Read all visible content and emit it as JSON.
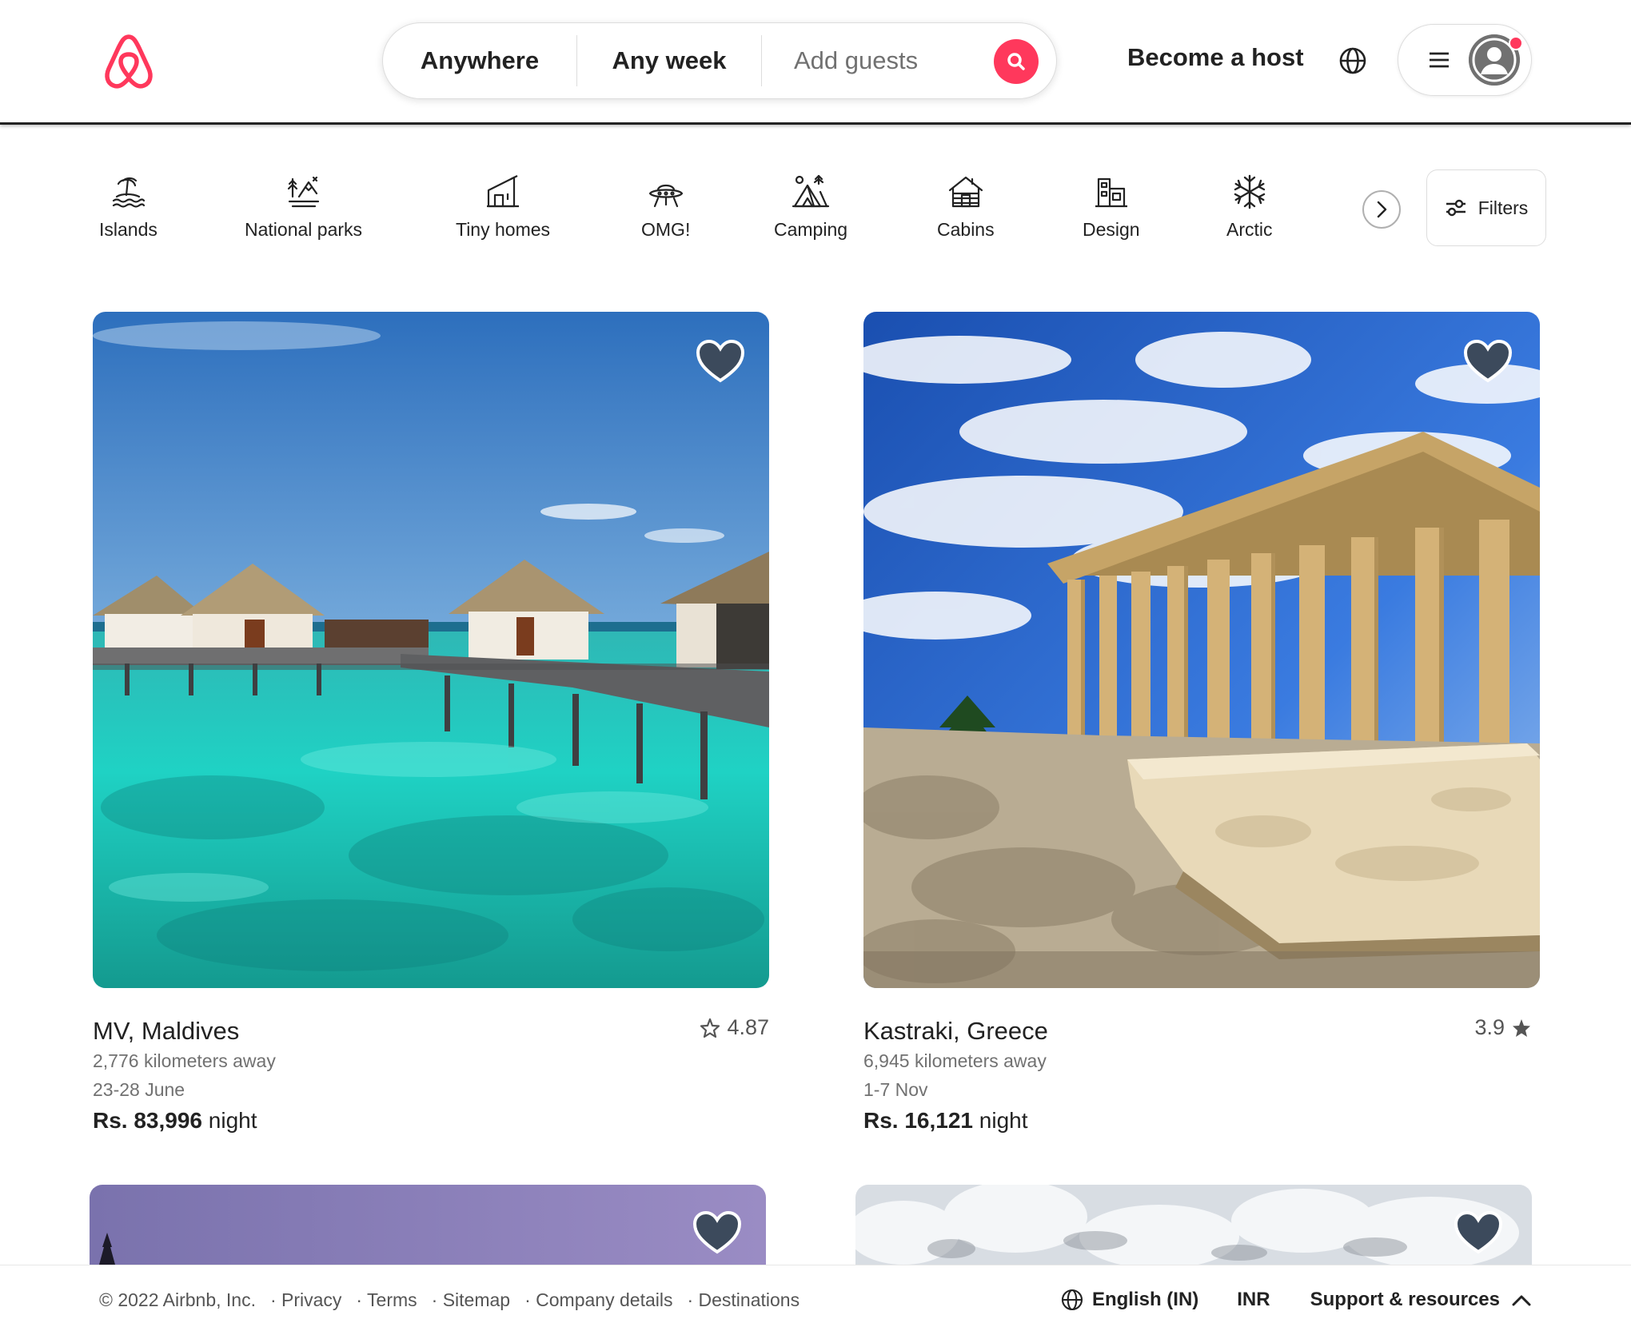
{
  "header": {
    "search": {
      "location": "Anywhere",
      "dates": "Any week",
      "guests_placeholder": "Add guests"
    },
    "become_host": "Become a host"
  },
  "categories": [
    {
      "label": "Islands",
      "icon": "islands-icon"
    },
    {
      "label": "National parks",
      "icon": "national-parks-icon"
    },
    {
      "label": "Tiny homes",
      "icon": "tiny-homes-icon"
    },
    {
      "label": "OMG!",
      "icon": "omg-icon"
    },
    {
      "label": "Camping",
      "icon": "camping-icon"
    },
    {
      "label": "Cabins",
      "icon": "cabins-icon"
    },
    {
      "label": "Design",
      "icon": "design-icon"
    },
    {
      "label": "Arctic",
      "icon": "arctic-icon"
    }
  ],
  "filters_label": "Filters",
  "listings": [
    {
      "location": "MV, Maldives",
      "rating": "4.87",
      "distance": "2,776 kilometers away",
      "dates": "23-28 June",
      "price": "Rs. 83,996",
      "price_unit": "night"
    },
    {
      "location": "Kastraki, Greece",
      "rating": "3.9",
      "distance": "6,945 kilometers away",
      "dates": "1-7 Nov",
      "price": "Rs. 16,121",
      "price_unit": "night"
    }
  ],
  "footer": {
    "copyright": "© 2022 Airbnb, Inc.",
    "links": [
      "· Privacy",
      "· Terms",
      "· Sitemap",
      "· Company details",
      "· Destinations"
    ],
    "language": "English (IN)",
    "currency": "INR",
    "support": "Support & resources"
  },
  "colors": {
    "brand": "#ff385c",
    "text": "#222222",
    "secondary_text": "#717171",
    "heart_fill": "#3c4a5c"
  }
}
